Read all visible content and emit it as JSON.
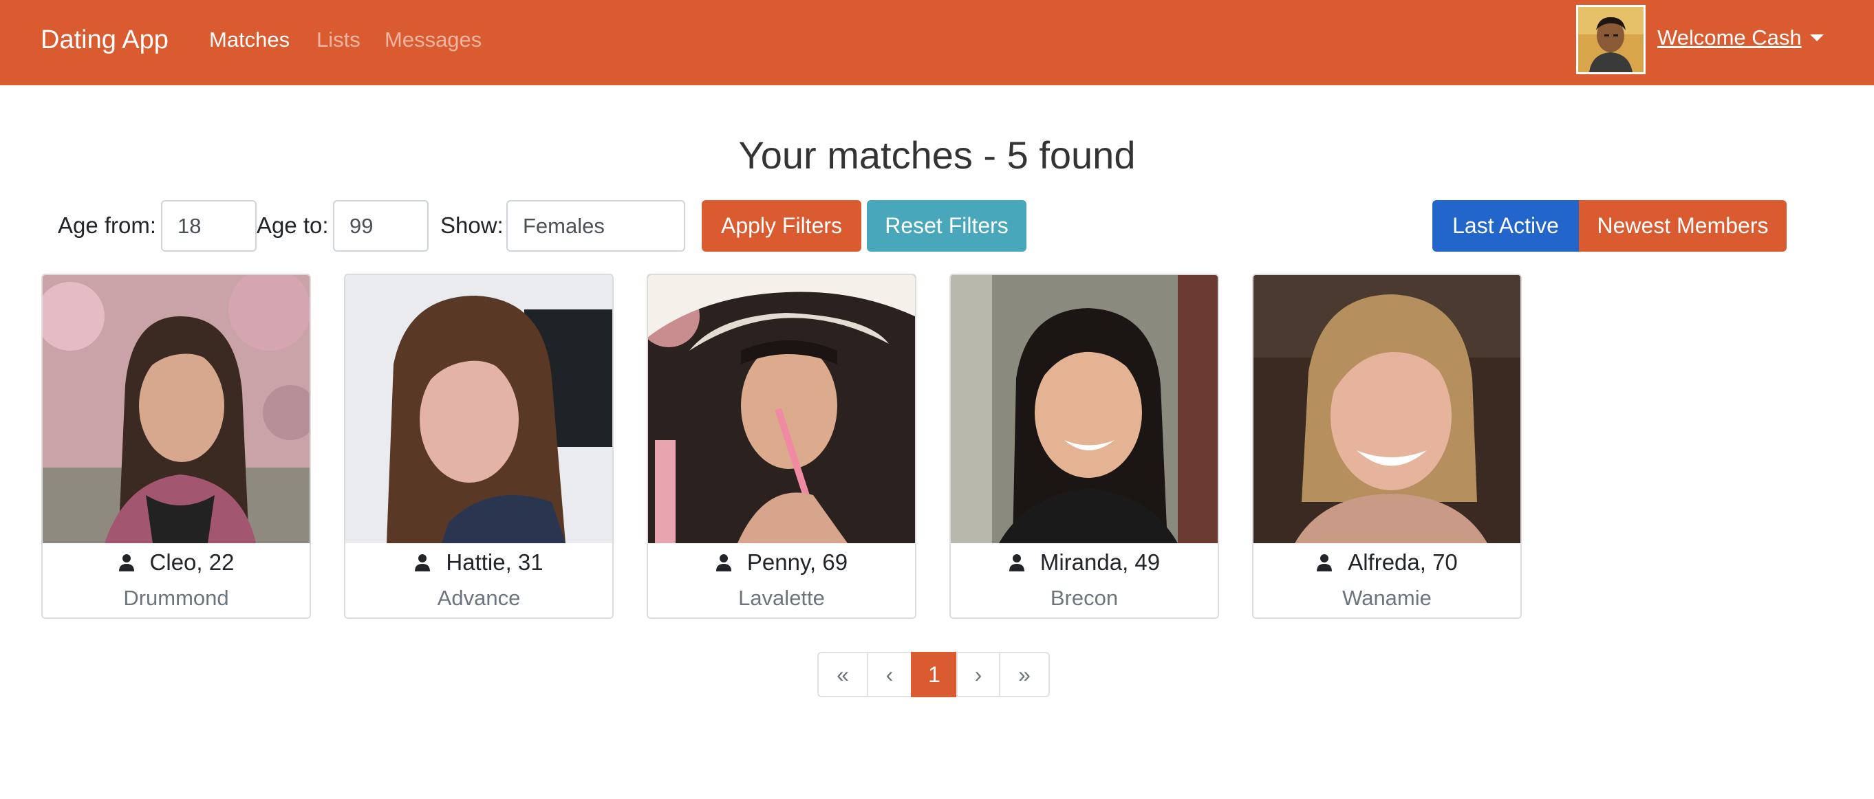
{
  "navbar": {
    "brand": "Dating App",
    "links": [
      {
        "label": "Matches",
        "active": true
      },
      {
        "label": "Lists",
        "active": false
      },
      {
        "label": "Messages",
        "active": false
      }
    ],
    "welcome": "Welcome Cash",
    "accent_color": "#db5b31"
  },
  "page": {
    "title": "Your matches - 5 found"
  },
  "filters": {
    "age_from_label": "Age from:",
    "age_from_value": "18",
    "age_to_label": "Age to:",
    "age_to_value": "99",
    "show_label": "Show:",
    "show_value": "Females",
    "apply_label": "Apply Filters",
    "reset_label": "Reset Filters",
    "order_by": [
      {
        "label": "Last Active",
        "active": true
      },
      {
        "label": "Newest Members",
        "active": false
      }
    ]
  },
  "members": [
    {
      "name_age": "Cleo, 22",
      "city": "Drummond",
      "icon": "user-icon"
    },
    {
      "name_age": "Hattie, 31",
      "city": "Advance",
      "icon": "user-icon"
    },
    {
      "name_age": "Penny, 69",
      "city": "Lavalette",
      "icon": "user-icon"
    },
    {
      "name_age": "Miranda, 49",
      "city": "Brecon",
      "icon": "user-icon"
    },
    {
      "name_age": "Alfreda, 70",
      "city": "Wanamie",
      "icon": "user-icon"
    }
  ],
  "pagination": {
    "first": "«",
    "prev": "‹",
    "current": "1",
    "next": "›",
    "last": "»"
  }
}
